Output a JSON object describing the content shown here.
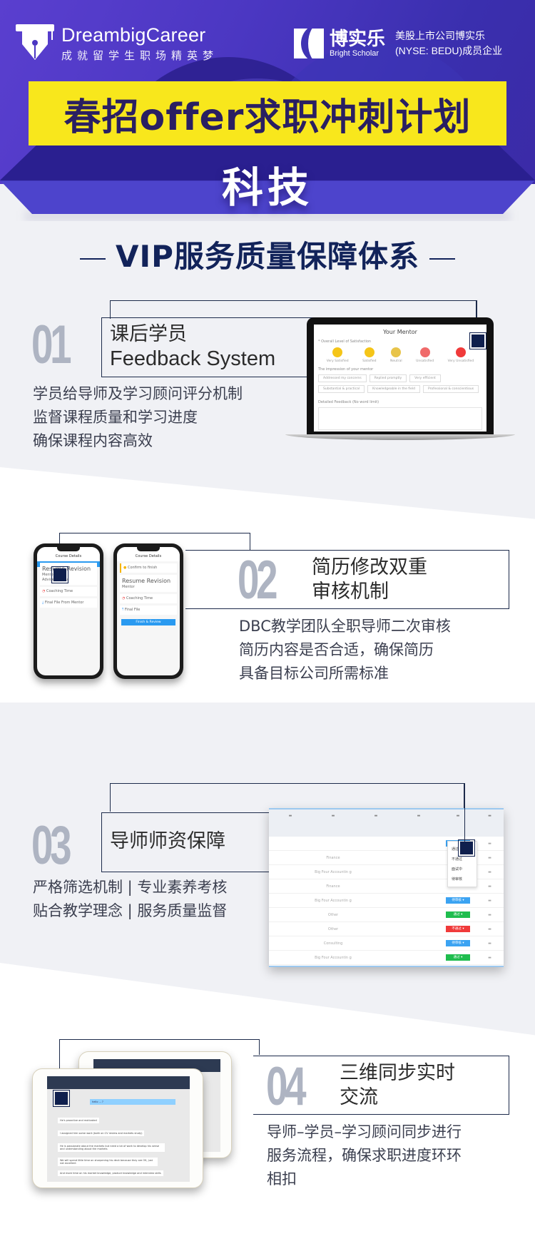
{
  "header": {
    "brand_name": "DreambigCareer",
    "brand_tagline": "成就留学生职场精英梦",
    "partner_name_cn": "博实乐",
    "partner_name_en": "Bright Scholar",
    "partner_desc_line1": "美股上市公司博实乐",
    "partner_desc_line2": "(NYSE: BEDU)成员企业",
    "title": "春招offer求职冲刺计划",
    "subtitle": "科技"
  },
  "section_heading": "VIP服务质量保障体系",
  "features": [
    {
      "number": "01",
      "title_line1": "课后学员",
      "title_line2": "Feedback System",
      "desc": [
        "学员给导师及学习顾问评分机制",
        "监督课程质量和学习进度",
        "确保课程内容高效"
      ],
      "screen": {
        "title": "Your Mentor",
        "satisfaction_label": "* Overall Level of Satisfaction",
        "ratings": [
          "Very Satisfied",
          "Satisfied",
          "Neutral",
          "Unsatisfied",
          "Very Unsatisfied"
        ],
        "rating_colors": [
          "#f5c518",
          "#f5c518",
          "#e8c44a",
          "#f06a6a",
          "#f03a3a"
        ],
        "impression_label": "The impression of your mentor",
        "tags": [
          "Addressed my concerns",
          "Replied promptly",
          "Very efficient",
          "Substantial & practical",
          "Knowledgeable in the field",
          "Professional & conscientious"
        ],
        "feedback_label": "Detailed Feedback (No word limit)",
        "device_label": "MacBook"
      }
    },
    {
      "number": "02",
      "title_line1": "简历修改双重",
      "title_line2": "审核机制",
      "desc": [
        "DBC教学团队全职导师二次审核",
        "简历内容是否合适，确保简历",
        "具备目标公司所需标准"
      ],
      "screen": {
        "header": "Course Details",
        "course": "Resume Revision",
        "mentor_label": "Mentor",
        "advice_label": "Advice for you",
        "coaching_label": "Coaching Time",
        "final_file_mentor": "Final File From Mentor",
        "confirm_label": "Confirm to finish",
        "final_file": "Final File",
        "button": "Finish & Review"
      }
    },
    {
      "number": "03",
      "title_line1": "导师师资保障",
      "title_line2": "",
      "desc": [
        "严格筛选机制 | 专业素养考核",
        "贴合教学理念 | 服务质量监督"
      ],
      "screen": {
        "dropdown_options": [
          "通过",
          "不通过",
          "面试中",
          "待审核"
        ],
        "status_rows": [
          {
            "col2": "",
            "status": "待审核",
            "color": "blue"
          },
          {
            "col2": "Finance",
            "status": "",
            "color": ""
          },
          {
            "col2": "Big Four Accountin g",
            "status": "",
            "color": ""
          },
          {
            "col2": "Finance",
            "status": "",
            "color": ""
          },
          {
            "col2": "Big Four Accountin g",
            "status": "待审核",
            "color": "blue"
          },
          {
            "col2": "Other",
            "status": "通过",
            "color": "green"
          },
          {
            "col2": "Other",
            "status": "不通过",
            "color": "red"
          },
          {
            "col2": "Consulting",
            "status": "待审核",
            "color": "blue"
          },
          {
            "col2": "Big Four Accountin g",
            "status": "通过",
            "color": "green"
          },
          {
            "col2": "",
            "status": "待审核",
            "color": "blue"
          }
        ]
      }
    },
    {
      "number": "04",
      "title_line1": "三维同步实时",
      "title_line2": "交流",
      "desc": [
        "导师–学员–学习顾问同步进行",
        "服务流程，确保求职进度环环",
        "相扣"
      ],
      "screen": {
        "messages": [
          "He's proactive and motivated",
          "I assigned him some work (both on CV review and markets study)",
          "He is passionate about the markets but need a lot of work to develop his sense and understanding about the markets",
          "We will spend little time on sharpening his deck because they are OK, just not excellent",
          "And more time on his market knowledge, product knowledge and interview skills"
        ]
      }
    }
  ],
  "colors": {
    "hero_purple": "#4b37c2",
    "title_yellow": "#f8e71c",
    "title_text": "#2a1f62",
    "navy": "#12235a",
    "number_grey": "#aeb4c2",
    "accent_blue": "#2a9af0"
  }
}
